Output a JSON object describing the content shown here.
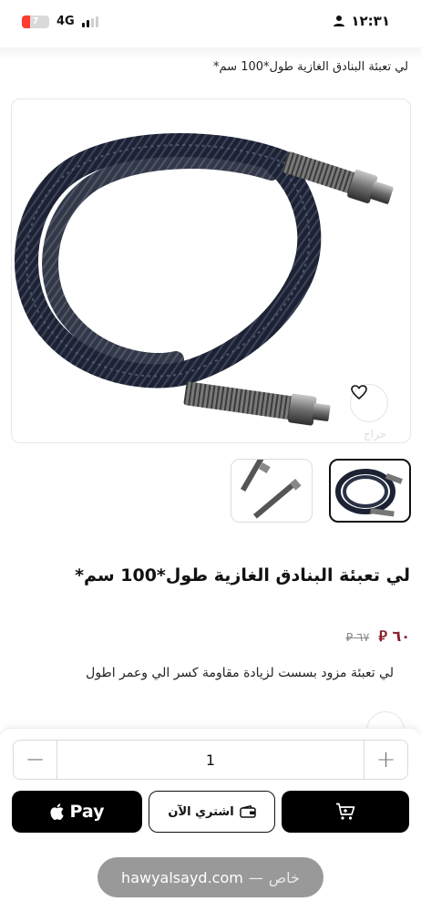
{
  "status_bar": {
    "time": "١٢:٣١",
    "network": "4G",
    "battery": "7"
  },
  "page": {
    "top_title": "لي تعبئة البنادق الغازية طول*100 سم*"
  },
  "product": {
    "title": "لي تعبئة البنادق الغازية طول*100 سم*",
    "price_current": "٦٠",
    "price_old": "٦٧",
    "currency_symbol": "⃁",
    "description": "لي تعبئة مزود بسست لزيادة مقاومة كسر الي وعمر اطول",
    "watermark": "حراج"
  },
  "purchase": {
    "quantity": "1",
    "minus_label": "−",
    "plus_label": "+",
    "apple_pay_label": "Pay",
    "buy_now_label": "اشتري الآن"
  },
  "browser": {
    "host": "hawyalsayd.com",
    "separator": "—",
    "mode": "خاص"
  },
  "icons": {
    "status_person": "person-icon",
    "favorite": "heart-icon",
    "cart": "cart-icon",
    "wallet": "wallet-icon",
    "apple": "apple-logo-icon"
  },
  "colors": {
    "price": "#8a1d2b",
    "primary_button": "#000000",
    "battery_low": "#ff3b30"
  }
}
